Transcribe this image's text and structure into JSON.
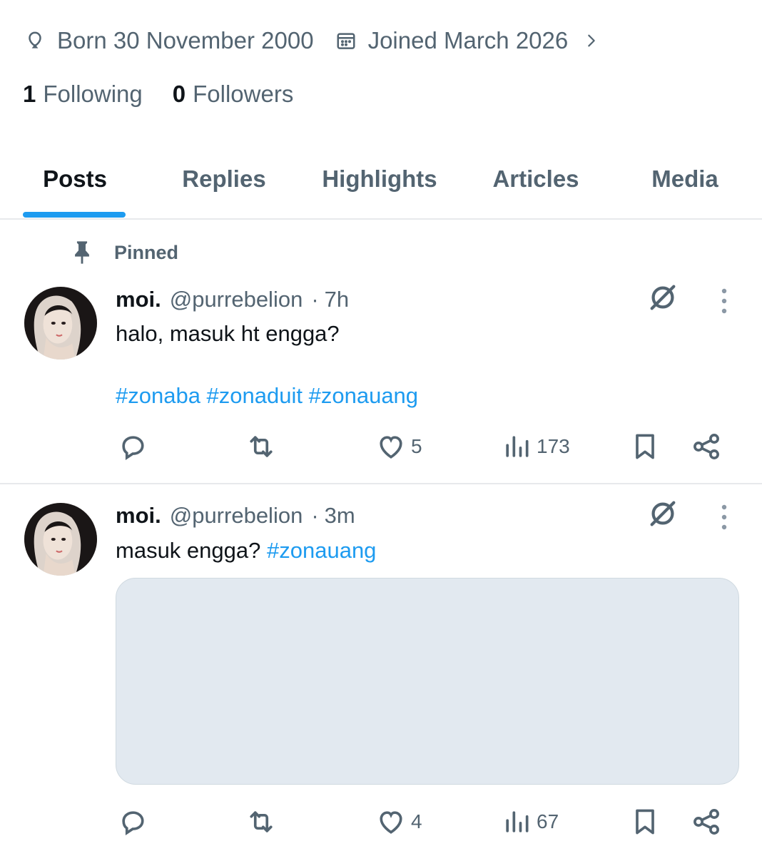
{
  "profile": {
    "birth": "Born 30 November 2000",
    "joined": "Joined March 2026",
    "following_count": "1",
    "following_label": "Following",
    "followers_count": "0",
    "followers_label": "Followers"
  },
  "tabs": [
    {
      "label": "Posts",
      "active": true
    },
    {
      "label": "Replies",
      "active": false
    },
    {
      "label": "Highlights",
      "active": false
    },
    {
      "label": "Articles",
      "active": false
    },
    {
      "label": "Media",
      "active": false
    }
  ],
  "pinned_label": "Pinned",
  "posts": [
    {
      "name": "moi.",
      "handle": "@purrebelion",
      "time": "7h",
      "text": "halo, masuk ht engga?",
      "hashtags": "#zonaba #zonaduit #zonauang",
      "likes": "5",
      "views": "173"
    },
    {
      "name": "moi.",
      "handle": "@purrebelion",
      "time": "3m",
      "text": "masuk engga?",
      "hashtags": "#zonauang",
      "likes": "4",
      "views": "67"
    }
  ],
  "colors": {
    "accent": "#1d9bf0",
    "text": "#0f1419",
    "secondary": "#536471",
    "divider": "#e7e9ec",
    "media_placeholder": "#e2e9f0"
  },
  "icons": [
    "balloon-icon",
    "calendar-icon",
    "chevron-right-icon",
    "pin-icon",
    "grok-icon",
    "more-icon",
    "reply-icon",
    "repost-icon",
    "like-icon",
    "views-icon",
    "bookmark-icon",
    "share-icon"
  ]
}
